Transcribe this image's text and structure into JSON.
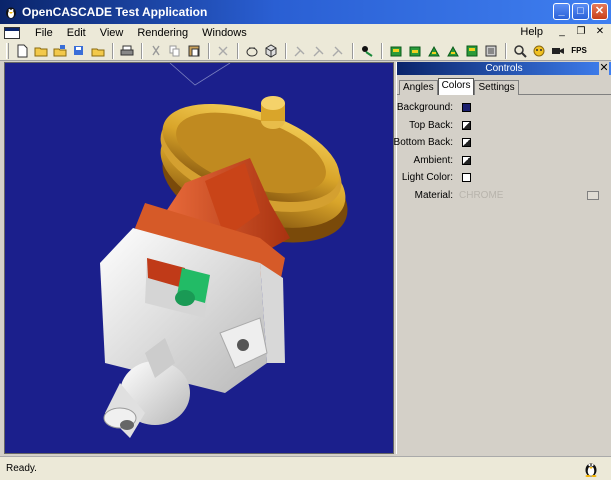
{
  "window": {
    "title": "OpenCASCADE Test Application"
  },
  "menu": {
    "items": [
      "File",
      "Edit",
      "View",
      "Rendering",
      "Windows"
    ],
    "help": "Help"
  },
  "toolbar": {
    "icons": [
      "new-icon",
      "open-icon",
      "save-icon",
      "save-as-icon",
      "export-icon",
      "print-icon",
      "cut-icon",
      "copy-icon",
      "paste-icon",
      "delete-icon",
      "wireframe-icon",
      "shaded-icon",
      "zoom-fit-icon",
      "zoom-in-icon",
      "zoom-out-icon",
      "pan-icon",
      "view-front-icon",
      "view-top-icon",
      "view-left-icon",
      "view-back-icon",
      "view-iso-icon",
      "view-reset-icon",
      "zoom-icon",
      "rotate-icon",
      "camera-icon"
    ],
    "fps_label": "FPS"
  },
  "controls": {
    "header": "Controls",
    "tabs": [
      "Angles",
      "Colors",
      "Settings"
    ],
    "active_tab": "Colors",
    "rows": [
      {
        "label": "Background:",
        "color": "#1b1f6e"
      },
      {
        "label": "Top Back:",
        "color": "#2a2a2a"
      },
      {
        "label": "Bottom Back:",
        "color": "#2a2a2a"
      },
      {
        "label": "Ambient:",
        "color": "#2a2a2a"
      },
      {
        "label": "Light Color:",
        "color": "#ffffff"
      }
    ],
    "material": {
      "label": "Material:",
      "value": "CHROME"
    }
  },
  "status": {
    "text": "Ready."
  },
  "colors": {
    "viewport_bg": "#1b1f8c",
    "pulley": "#d9a52a",
    "housing_red": "#d04a1e",
    "body_white": "#eeeeee",
    "accent_green": "#22bb66"
  }
}
